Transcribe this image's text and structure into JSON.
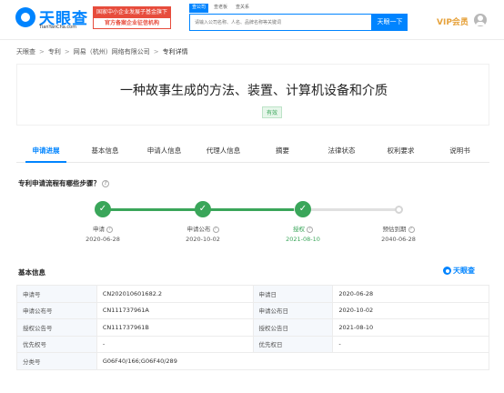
{
  "header": {
    "logo_text": "天眼查",
    "logo_sub": "TianYanCha.com",
    "badge_line1": "国家中小企业发展子基金旗下",
    "badge_line2": "官方备案企业征信机构",
    "search_tabs": [
      "查公司",
      "查老板",
      "查关系"
    ],
    "search_placeholder": "请输入公司名称、人名、品牌名称等关键词",
    "search_button": "天眼一下",
    "vip_label": "VIP会员",
    "vip_caret": "▾",
    "accent_color": "#0084ff"
  },
  "breadcrumb": [
    "天眼查",
    "专利",
    "网易（杭州）网络有限公司",
    "专利详情"
  ],
  "breadcrumb_sep": ">",
  "patent": {
    "title": "一种故事生成的方法、装置、计算机设备和介质",
    "status": "有效",
    "status_color": "#3aa65a"
  },
  "tabs": [
    "申请进展",
    "基本信息",
    "申请人信息",
    "代理人信息",
    "摘要",
    "法律状态",
    "权利要求",
    "说明书"
  ],
  "progress": {
    "question": "专利申请流程有哪些步骤？",
    "check": "✓",
    "help": "?",
    "steps": [
      {
        "label": "申请",
        "date": "2020-06-28"
      },
      {
        "label": "申请公布",
        "date": "2020-10-02"
      },
      {
        "label": "授权",
        "date": "2021-08-10"
      },
      {
        "label": "预估到期",
        "date": "2040-06-28"
      }
    ]
  },
  "basic_info": {
    "heading": "基本信息",
    "brand": "天眼查",
    "rows": [
      [
        {
          "k": "申请号",
          "v": "CN202010601682.2"
        },
        {
          "k": "申请日",
          "v": "2020-06-28"
        }
      ],
      [
        {
          "k": "申请公布号",
          "v": "CN111737961A"
        },
        {
          "k": "申请公布日",
          "v": "2020-10-02"
        }
      ],
      [
        {
          "k": "授权公告号",
          "v": "CN111737961B"
        },
        {
          "k": "授权公告日",
          "v": "2021-08-10"
        }
      ],
      [
        {
          "k": "优先权号",
          "v": "-"
        },
        {
          "k": "优先权日",
          "v": "-"
        }
      ]
    ],
    "classification": {
      "k": "分类号",
      "v": "G06F40/166;G06F40/289"
    }
  }
}
